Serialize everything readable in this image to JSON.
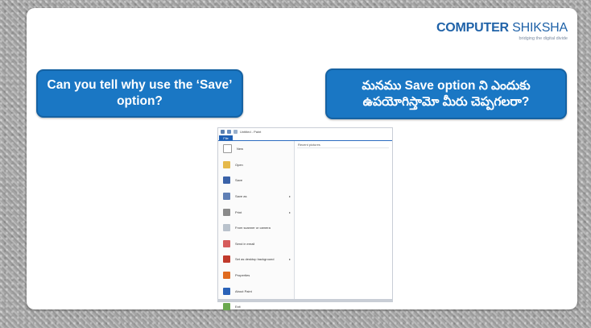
{
  "logo": {
    "main_a": "COMPUTER",
    "main_b": "SHIKSHA",
    "tagline": "bridging the digital divide"
  },
  "questions": {
    "english": "Can you tell why use the ‘Save’ option?",
    "telugu": "మనము Save option ని ఎందుకు ఉపయోగిస్తామో మీరు చెప్పగలరా?"
  },
  "paint_window": {
    "title": "Untitled - Paint",
    "file_tab": "File",
    "recent_heading": "Recent pictures",
    "menu_items": [
      {
        "label": "New",
        "icon": "new-file-icon",
        "color": "#ffffff",
        "arrow": false
      },
      {
        "label": "Open",
        "icon": "open-folder-icon",
        "color": "#e5b94a",
        "arrow": false
      },
      {
        "label": "Save",
        "icon": "save-disk-icon",
        "color": "#3a62a8",
        "arrow": false
      },
      {
        "label": "Save as",
        "icon": "save-as-icon",
        "color": "#5f7fb5",
        "arrow": true
      },
      {
        "label": "Print",
        "icon": "printer-icon",
        "color": "#8a8a8a",
        "arrow": true
      },
      {
        "label": "From scanner or camera",
        "icon": "scanner-icon",
        "color": "#b9c2cc",
        "arrow": false
      },
      {
        "label": "Send in email",
        "icon": "email-icon",
        "color": "#d65b5b",
        "arrow": false
      },
      {
        "label": "Set as desktop background",
        "icon": "desktop-background-icon",
        "color": "#c0392b",
        "arrow": true
      },
      {
        "label": "Properties",
        "icon": "checkmark-icon",
        "color": "#e06b1e",
        "arrow": false
      },
      {
        "label": "About Paint",
        "icon": "info-icon",
        "color": "#2a62b8",
        "arrow": false
      },
      {
        "label": "Exit",
        "icon": "exit-icon",
        "color": "#6aa84f",
        "arrow": false
      }
    ]
  }
}
